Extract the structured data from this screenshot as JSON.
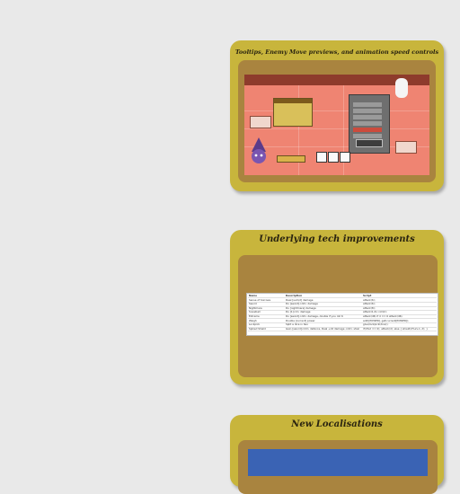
{
  "cards": [
    {
      "title": "Tooltips, Enemy Move previews, and animation speed controls"
    },
    {
      "title": "Underlying tech improvements"
    },
    {
      "title": "New Localisations"
    }
  ],
  "spreadsheet": {
    "headers": [
      "Name",
      "Description",
      "Script"
    ],
    "rows": [
      [
        "Sense of Sorrows",
        "Deal [sum/2] damage",
        "attack(6);"
      ],
      [
        "Sword",
        "Do [sword]<dd> damage",
        "attack(6);"
      ],
      [
        "Nightmare",
        "Do [nightmare] damage",
        "attack(8);"
      ],
      [
        "Snowball",
        "Do [1]<d> damage",
        "attack(1-6); roll(2);"
      ],
      [
        "Extreme",
        "Do [sword]<dd> damage, double if you roll 6",
        "attack(d6) if d == 6 attack(d6);"
      ],
      [
        "Weigh",
        "Double [current] power",
        "add([POWER], get(current[POWER]);"
      ],
      [
        "Lockpick",
        "Split a dice in two",
        "give(lockpick(dice));"
      ],
      [
        "Spiked Shield",
        "Gain [sword]<dd> defence, Deal +dd damage <dd> shield",
        "if(d%2 == 0); attack(d); else { shield(d%2+1, d); }"
      ]
    ]
  }
}
